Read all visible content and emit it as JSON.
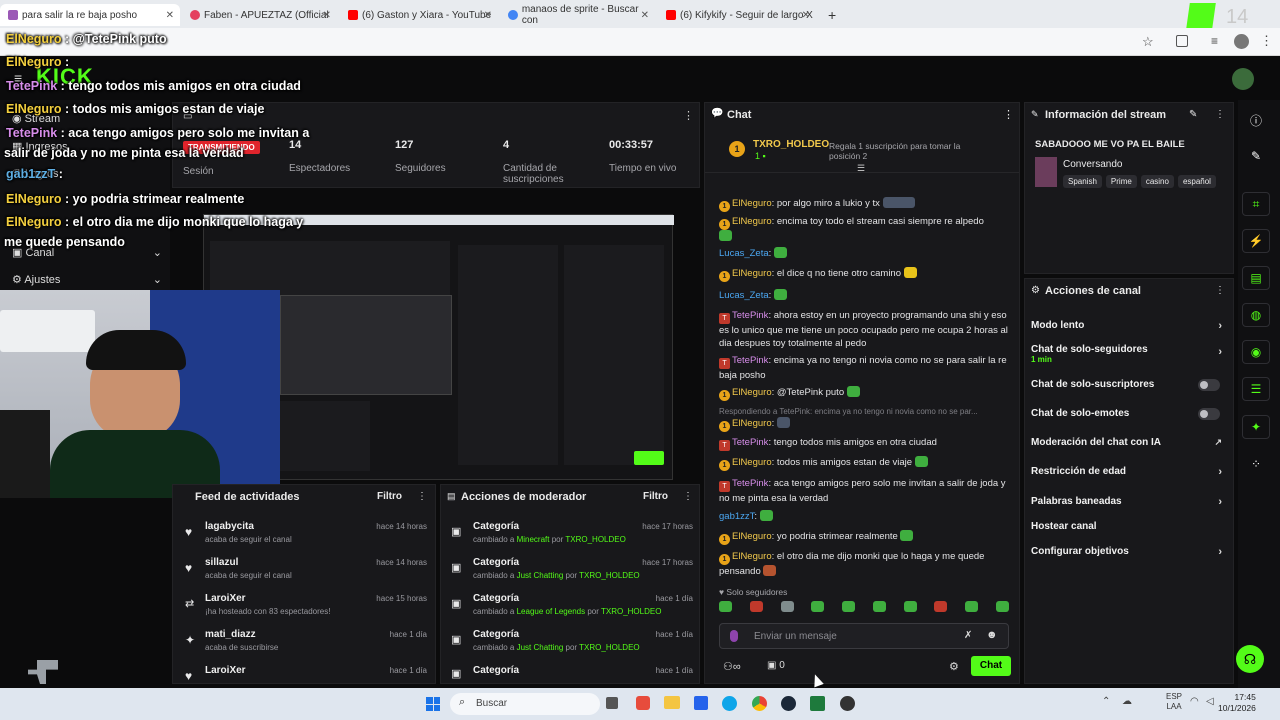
{
  "browser": {
    "tabs": [
      {
        "label": "para salir la re baja posho"
      },
      {
        "label": "Faben - APUEZTAZ (Official"
      },
      {
        "label": "(6) Gaston y Xiara - YouTube"
      },
      {
        "label": "manaos de sprite - Buscar con"
      },
      {
        "label": "(6) Kifykify - Seguir de largo X"
      }
    ],
    "new_tab": "+",
    "corner_text": "14"
  },
  "overlay_chat": [
    {
      "user": "ElNeguro",
      "sep": " : @TetePink puto"
    },
    {
      "user": "ElNeguro",
      "sep": " :"
    },
    {
      "user": "TetePink",
      "sep": " : tengo todos mis amigos en otra ciudad"
    },
    {
      "user": "ElNeguro",
      "sep": " : todos mis amigos estan de viaje"
    },
    {
      "user": "TetePink",
      "sep": " : aca tengo amigos pero solo me invitan a"
    },
    {
      "user": "",
      "sep": "salir de joda y no me pinta esa la verdad"
    },
    {
      "user": "gab1zzT",
      "sep": " :"
    },
    {
      "user": "ElNeguro",
      "sep": " : yo podria strimear realmente"
    },
    {
      "user": "ElNeguro",
      "sep": " : el otro dia me dijo monki que lo haga y"
    },
    {
      "user": "",
      "sep": "me quede pensando"
    }
  ],
  "sidebar": {
    "items": [
      {
        "label": "Stream"
      },
      {
        "label": "Ingresos"
      },
      {
        "label": "Logros"
      },
      {
        "label": "Canal"
      },
      {
        "label": "Ajustes"
      }
    ]
  },
  "stats": {
    "live_badge": "TRANSMITIENDO",
    "session_label": "Sesión",
    "items": [
      {
        "value": "14",
        "label": "Espectadores"
      },
      {
        "value": "127",
        "label": "Seguidores"
      },
      {
        "value": "4",
        "label": "Cantidad de suscripciones"
      },
      {
        "value": "00:33:57",
        "label": "Tiempo en vivo"
      }
    ]
  },
  "activity": {
    "title": "Feed de actividades",
    "filter": "Filtro",
    "rows": [
      {
        "name": "lagabycita",
        "desc": "acaba de seguir el canal",
        "time": "hace 14 horas"
      },
      {
        "name": "sillazul",
        "desc": "acaba de seguir el canal",
        "time": "hace 14 horas"
      },
      {
        "name": "LaroiXer",
        "desc": "¡ha hosteado con 83 espectadores!",
        "time": "hace 15 horas"
      },
      {
        "name": "mati_diazz",
        "desc": "acaba de suscribirse",
        "time": "hace 1 día"
      },
      {
        "name": "LaroiXer",
        "desc": "",
        "time": "hace 1 día"
      }
    ]
  },
  "modactions": {
    "title": "Acciones de moderador",
    "filter": "Filtro",
    "rows": [
      {
        "name": "Categoría",
        "pre": "cambiado a ",
        "cat": "Minecraft",
        "by": " por ",
        "mod": "TXRO_HOLDEO",
        "time": "hace 17 horas"
      },
      {
        "name": "Categoría",
        "pre": "cambiado a ",
        "cat": "Just Chatting",
        "by": " por ",
        "mod": "TXRO_HOLDEO",
        "time": "hace 17 horas"
      },
      {
        "name": "Categoría",
        "pre": "cambiado a ",
        "cat": "League of Legends",
        "by": " por ",
        "mod": "TXRO_HOLDEO",
        "time": "hace 1 día"
      },
      {
        "name": "Categoría",
        "pre": "cambiado a ",
        "cat": "Just Chatting",
        "by": " por ",
        "mod": "TXRO_HOLDEO",
        "time": "hace 1 día"
      },
      {
        "name": "Categoría",
        "pre": "",
        "cat": "",
        "by": "",
        "mod": "",
        "time": "hace 1 día"
      }
    ]
  },
  "chat": {
    "title": "Chat",
    "pinned_user": "TXRO_HOLDEO",
    "pinned_rank": "1",
    "gift_text": "Regala 1 suscripción para tomar la posición 2",
    "messages": [
      {
        "user": "ElNeguro",
        "cls": "uy",
        "text": ": por algo miro a lukio y tx"
      },
      {
        "user": "ElNeguro",
        "cls": "uy",
        "text": ": encima toy todo el stream casi siempre re alpedo"
      },
      {
        "user": "Lucas_Zeta",
        "cls": "ub",
        "text": ":"
      },
      {
        "user": "ElNeguro",
        "cls": "uy",
        "text": ": el dice q no tiene otro camino"
      },
      {
        "user": "Lucas_Zeta",
        "cls": "ub",
        "text": ":"
      },
      {
        "user": "TetePink",
        "cls": "up",
        "text": ": ahora estoy en un proyecto programando una shi y eso es lo unico que me tiene un poco ocupado pero me ocupa 2 horas al dia despues toy totalmente al pedo"
      },
      {
        "user": "TetePink",
        "cls": "up",
        "text": ": encima ya no tengo ni novia como no se para salir la re baja posho"
      },
      {
        "user": "ElNeguro",
        "cls": "uy",
        "text": ": @TetePink puto"
      },
      {
        "user": "ElNeguro",
        "cls": "uy",
        "text": ":"
      },
      {
        "user": "TetePink",
        "cls": "up",
        "text": ": tengo todos mis amigos en otra ciudad"
      },
      {
        "user": "ElNeguro",
        "cls": "uy",
        "text": ": todos mis amigos estan de viaje"
      },
      {
        "user": "TetePink",
        "cls": "up",
        "text": ": aca tengo amigos pero solo me invitan a salir de joda y no me pinta esa la verdad"
      },
      {
        "user": "gab1zzT",
        "cls": "ub",
        "text": ":"
      },
      {
        "user": "ElNeguro",
        "cls": "uy",
        "text": ": yo podria strimear realmente"
      },
      {
        "user": "ElNeguro",
        "cls": "uy",
        "text": ": el otro dia me dijo monki que lo haga y me quede pensando"
      }
    ],
    "reply_note": "Respondiendo a TetePink: encima ya no tengo ni novia como no se par...",
    "followers_only": "Solo seguidores",
    "input_placeholder": "Enviar un mensaje",
    "points": "0",
    "send_label": "Chat"
  },
  "streaminfo": {
    "title": "Información del stream",
    "stream_title": "SABADOOO ME VO PA EL BAILE",
    "category": "Conversando",
    "tags": [
      "Spanish",
      "Prime",
      "casino",
      "español"
    ]
  },
  "channel_actions": {
    "title": "Acciones de canal",
    "items": [
      {
        "label": "Modo lento",
        "sub": "",
        "ctrl": "chevron"
      },
      {
        "label": "Chat de solo-seguidores",
        "sub": "1 min",
        "ctrl": "chevron"
      },
      {
        "label": "Chat de solo-suscriptores",
        "sub": "",
        "ctrl": "toggle"
      },
      {
        "label": "Chat de solo-emotes",
        "sub": "",
        "ctrl": "toggle"
      },
      {
        "label": "Moderación del chat con IA",
        "sub": "",
        "ctrl": "ext"
      },
      {
        "label": "Restricción de edad",
        "sub": "",
        "ctrl": "chevron"
      },
      {
        "label": "Palabras baneadas",
        "sub": "",
        "ctrl": "chevron"
      },
      {
        "label": "Hostear canal",
        "sub": "",
        "ctrl": "none"
      },
      {
        "label": "Configurar objetivos",
        "sub": "",
        "ctrl": "chevron"
      }
    ]
  },
  "taskbar": {
    "search": "Buscar",
    "lang": "ESP",
    "lang2": "LAA",
    "time": "17:45",
    "date": "10/1/2026"
  },
  "colors": {
    "accent": "#53fc18",
    "panel": "#18181b",
    "bg": "#0b0b0c",
    "gold": "#e8a318"
  }
}
